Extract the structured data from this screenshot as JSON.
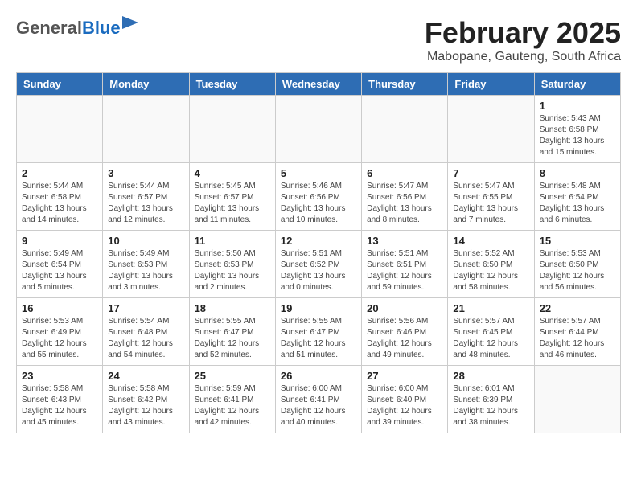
{
  "header": {
    "logo_general": "General",
    "logo_blue": "Blue",
    "month_title": "February 2025",
    "subtitle": "Mabopane, Gauteng, South Africa"
  },
  "days_of_week": [
    "Sunday",
    "Monday",
    "Tuesday",
    "Wednesday",
    "Thursday",
    "Friday",
    "Saturday"
  ],
  "weeks": [
    [
      {
        "day": "",
        "info": ""
      },
      {
        "day": "",
        "info": ""
      },
      {
        "day": "",
        "info": ""
      },
      {
        "day": "",
        "info": ""
      },
      {
        "day": "",
        "info": ""
      },
      {
        "day": "",
        "info": ""
      },
      {
        "day": "1",
        "info": "Sunrise: 5:43 AM\nSunset: 6:58 PM\nDaylight: 13 hours\nand 15 minutes."
      }
    ],
    [
      {
        "day": "2",
        "info": "Sunrise: 5:44 AM\nSunset: 6:58 PM\nDaylight: 13 hours\nand 14 minutes."
      },
      {
        "day": "3",
        "info": "Sunrise: 5:44 AM\nSunset: 6:57 PM\nDaylight: 13 hours\nand 12 minutes."
      },
      {
        "day": "4",
        "info": "Sunrise: 5:45 AM\nSunset: 6:57 PM\nDaylight: 13 hours\nand 11 minutes."
      },
      {
        "day": "5",
        "info": "Sunrise: 5:46 AM\nSunset: 6:56 PM\nDaylight: 13 hours\nand 10 minutes."
      },
      {
        "day": "6",
        "info": "Sunrise: 5:47 AM\nSunset: 6:56 PM\nDaylight: 13 hours\nand 8 minutes."
      },
      {
        "day": "7",
        "info": "Sunrise: 5:47 AM\nSunset: 6:55 PM\nDaylight: 13 hours\nand 7 minutes."
      },
      {
        "day": "8",
        "info": "Sunrise: 5:48 AM\nSunset: 6:54 PM\nDaylight: 13 hours\nand 6 minutes."
      }
    ],
    [
      {
        "day": "9",
        "info": "Sunrise: 5:49 AM\nSunset: 6:54 PM\nDaylight: 13 hours\nand 5 minutes."
      },
      {
        "day": "10",
        "info": "Sunrise: 5:49 AM\nSunset: 6:53 PM\nDaylight: 13 hours\nand 3 minutes."
      },
      {
        "day": "11",
        "info": "Sunrise: 5:50 AM\nSunset: 6:53 PM\nDaylight: 13 hours\nand 2 minutes."
      },
      {
        "day": "12",
        "info": "Sunrise: 5:51 AM\nSunset: 6:52 PM\nDaylight: 13 hours\nand 0 minutes."
      },
      {
        "day": "13",
        "info": "Sunrise: 5:51 AM\nSunset: 6:51 PM\nDaylight: 12 hours\nand 59 minutes."
      },
      {
        "day": "14",
        "info": "Sunrise: 5:52 AM\nSunset: 6:50 PM\nDaylight: 12 hours\nand 58 minutes."
      },
      {
        "day": "15",
        "info": "Sunrise: 5:53 AM\nSunset: 6:50 PM\nDaylight: 12 hours\nand 56 minutes."
      }
    ],
    [
      {
        "day": "16",
        "info": "Sunrise: 5:53 AM\nSunset: 6:49 PM\nDaylight: 12 hours\nand 55 minutes."
      },
      {
        "day": "17",
        "info": "Sunrise: 5:54 AM\nSunset: 6:48 PM\nDaylight: 12 hours\nand 54 minutes."
      },
      {
        "day": "18",
        "info": "Sunrise: 5:55 AM\nSunset: 6:47 PM\nDaylight: 12 hours\nand 52 minutes."
      },
      {
        "day": "19",
        "info": "Sunrise: 5:55 AM\nSunset: 6:47 PM\nDaylight: 12 hours\nand 51 minutes."
      },
      {
        "day": "20",
        "info": "Sunrise: 5:56 AM\nSunset: 6:46 PM\nDaylight: 12 hours\nand 49 minutes."
      },
      {
        "day": "21",
        "info": "Sunrise: 5:57 AM\nSunset: 6:45 PM\nDaylight: 12 hours\nand 48 minutes."
      },
      {
        "day": "22",
        "info": "Sunrise: 5:57 AM\nSunset: 6:44 PM\nDaylight: 12 hours\nand 46 minutes."
      }
    ],
    [
      {
        "day": "23",
        "info": "Sunrise: 5:58 AM\nSunset: 6:43 PM\nDaylight: 12 hours\nand 45 minutes."
      },
      {
        "day": "24",
        "info": "Sunrise: 5:58 AM\nSunset: 6:42 PM\nDaylight: 12 hours\nand 43 minutes."
      },
      {
        "day": "25",
        "info": "Sunrise: 5:59 AM\nSunset: 6:41 PM\nDaylight: 12 hours\nand 42 minutes."
      },
      {
        "day": "26",
        "info": "Sunrise: 6:00 AM\nSunset: 6:41 PM\nDaylight: 12 hours\nand 40 minutes."
      },
      {
        "day": "27",
        "info": "Sunrise: 6:00 AM\nSunset: 6:40 PM\nDaylight: 12 hours\nand 39 minutes."
      },
      {
        "day": "28",
        "info": "Sunrise: 6:01 AM\nSunset: 6:39 PM\nDaylight: 12 hours\nand 38 minutes."
      },
      {
        "day": "",
        "info": ""
      }
    ]
  ]
}
